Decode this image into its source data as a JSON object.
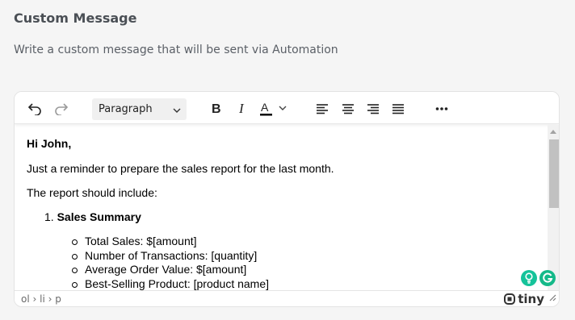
{
  "section": {
    "title": "Custom Message",
    "description": "Write a custom message that will be sent via Automation"
  },
  "toolbar": {
    "undo_icon": "undo-icon",
    "redo_icon": "redo-icon",
    "block_format": "Paragraph",
    "bold_icon": "bold-icon",
    "italic_icon": "italic-icon",
    "text_color_icon": "text-color-icon",
    "align_icons": [
      "align-left-icon",
      "align-center-icon",
      "align-right-icon",
      "align-justify-icon"
    ],
    "more_icon": "more-icon"
  },
  "content": {
    "greeting": "Hi John,",
    "reminder": "Just a reminder to prepare the sales report for the last month.",
    "include_line": "The report should include:",
    "ordered": [
      {
        "number": "1.",
        "label": "Sales Summary"
      }
    ],
    "bullets": [
      "Total Sales: $[amount]",
      "Number of Transactions: [quantity]",
      "Average Order Value: $[amount]",
      "Best-Selling Product: [product name]"
    ]
  },
  "statusbar": {
    "path": "ol › li › p",
    "brand": "tiny"
  },
  "colors": {
    "accent_green": "#15c39a",
    "grammarly_green": "#15b989"
  }
}
